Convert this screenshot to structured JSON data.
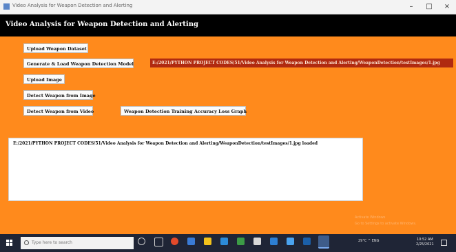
{
  "window": {
    "title": "Video Analysis for Weapon Detection and Alerting",
    "controls": {
      "minimize": "–",
      "maximize": "□",
      "close": "×"
    }
  },
  "app": {
    "header_title": "Video Analysis for Weapon Detection and Alerting",
    "buttons": {
      "upload_dataset": "Upload Weapon Dataset",
      "generate_model": "Generate & Load Weapon Detection Model",
      "upload_image": "Upload Image",
      "detect_image": "Detect Weapon from Image",
      "detect_video": "Detect Weapon from Video",
      "graph": "Weapon Detection Training Accuracy Loss Graph"
    },
    "path_label": "E:/2021/PYTHON PROJECT CODES/51/Video Analysis for Weapon Detection and Alerting/WeaponDetection/testImages/1.jpg",
    "output_text": "E:/2021/PYTHON PROJECT CODES/51/Video Analysis for Weapon Detection and Alerting/WeaponDetection/testImages/1.jpg loaded",
    "watermark": [
      "Activate Windows",
      "Go to Settings to activate Windows."
    ]
  },
  "taskbar": {
    "search_placeholder": "Type here to search",
    "tray_text": "29°C  ^  ENG",
    "clock_time": "10:52 AM",
    "clock_date": "2/25/2021"
  },
  "colors": {
    "background": "#ff8a1c",
    "header": "#000000",
    "path_label": "#b02a10"
  }
}
